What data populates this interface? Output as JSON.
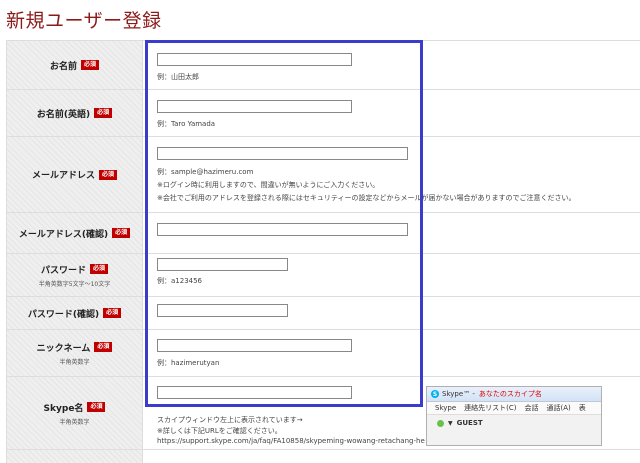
{
  "page": {
    "title": "新規ユーザー登録"
  },
  "required_badge": "必須",
  "fields": {
    "name": {
      "label": "お名前",
      "example": "例：山田太郎"
    },
    "name_en": {
      "label": "お名前(英語)",
      "example": "例：Taro Yamada"
    },
    "email": {
      "label": "メールアドレス",
      "example": "例：sample@hazimeru.com",
      "note1": "※ログイン時に利用しますので、間違いが無いようにご入力ください。",
      "note2": "※会社でご利用のアドレスを登録される際にはセキュリティーの設定などからメールが届かない場合がありますのでご注意ください。"
    },
    "email_confirm": {
      "label": "メールアドレス(確認)"
    },
    "password": {
      "label": "パスワード",
      "sub": "半角英数字5文字〜10文字",
      "example": "例：a123456"
    },
    "password_confirm": {
      "label": "パスワード(確認)"
    },
    "nickname": {
      "label": "ニックネーム",
      "sub": "半角英数字",
      "example": "例：hazimerutyan"
    },
    "skype": {
      "label": "Skype名",
      "sub": "半角英数字",
      "note1": "スカイプウィンドウ左上に表示されています→",
      "note2": "※詳しくは下記URLをご確認ください。",
      "url": "https://support.skype.com/ja/faq/FA10858/skypeming-wowang-retachang-he"
    }
  },
  "skype_window": {
    "title": "Skype™ -",
    "title_red": "あなたのスカイプ名",
    "menu": [
      "Skype",
      "連絡先リスト(C)",
      "会話",
      "通話(A)",
      "表"
    ],
    "user": "GUEST"
  },
  "colors": {
    "title": "#8b1a1a",
    "required": "#c00000",
    "highlight": "#3c3ccc"
  }
}
